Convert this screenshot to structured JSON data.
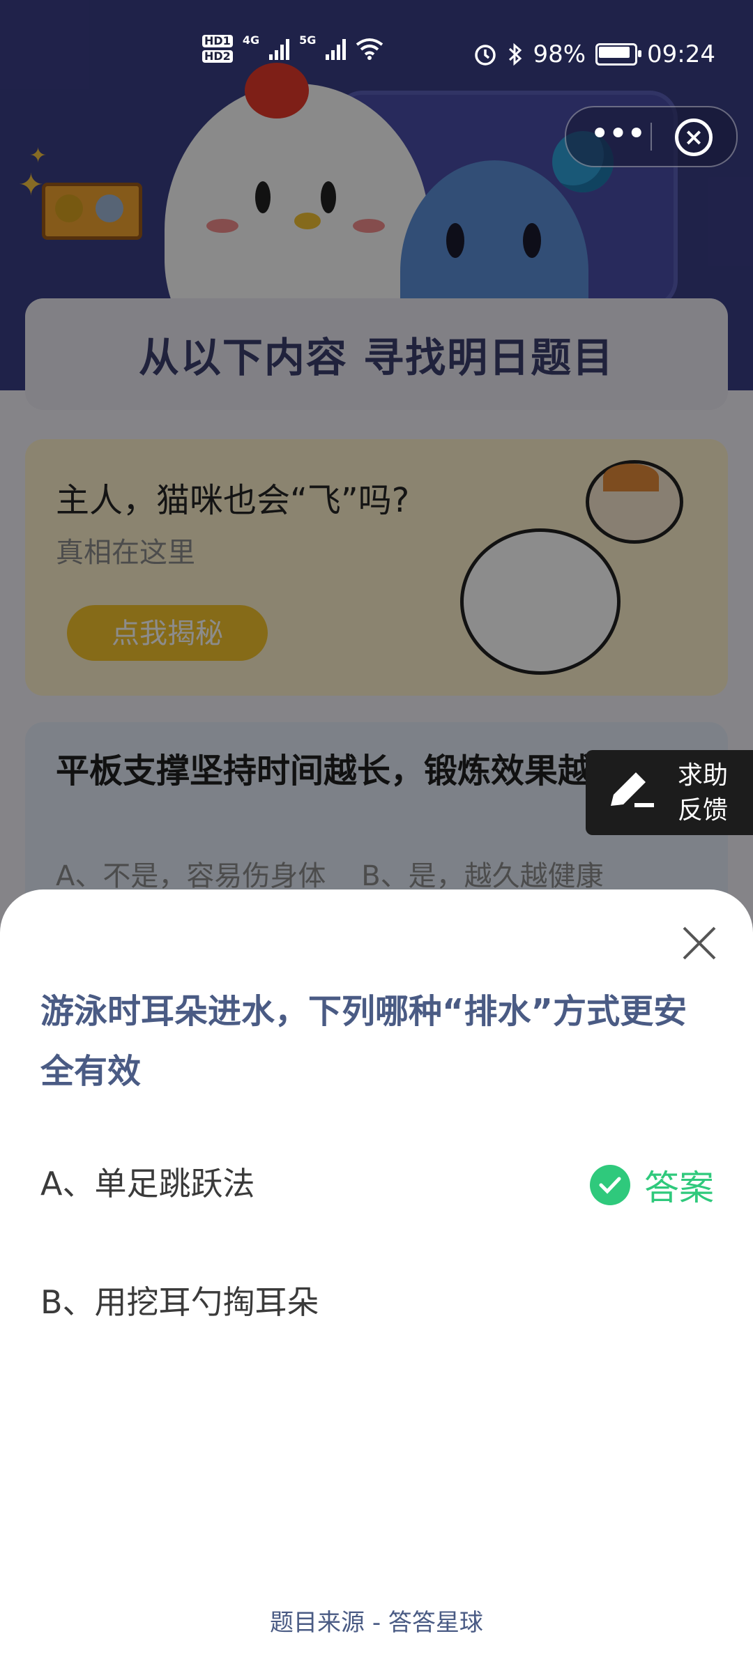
{
  "status_bar": {
    "hd1": "HD1",
    "hd2": "HD2",
    "net1": "4G",
    "net2": "5G",
    "battery": "98%",
    "time": "09:24"
  },
  "capsule": {
    "more_icon": "more-dots-icon",
    "close_icon": "close-circle-icon"
  },
  "page": {
    "title": "从以下内容  寻找明日题目",
    "cat_card": {
      "question": "主人，猫咪也会“飞”吗?",
      "subtitle": "真相在这里",
      "button": "点我揭秘"
    },
    "plank_card": {
      "question": "平板支撑坚持时间越长，锻炼效果越好吗",
      "options": "A、不是，容易伤身体    B、是，越久越健康"
    }
  },
  "help_float": {
    "line1": "求助",
    "line2": "反馈"
  },
  "sheet": {
    "question": "游泳时耳朵进水，下列哪种“排水”方式更安全有效",
    "option_a": "A、单足跳跃法",
    "option_b": "B、用挖耳勺掏耳朵",
    "answer_label": "答案",
    "source": "题目来源 - 答答星球"
  },
  "colors": {
    "accent_green": "#2fc97c",
    "question_blue": "#4a5b84",
    "button_yellow": "#f5c42c"
  }
}
